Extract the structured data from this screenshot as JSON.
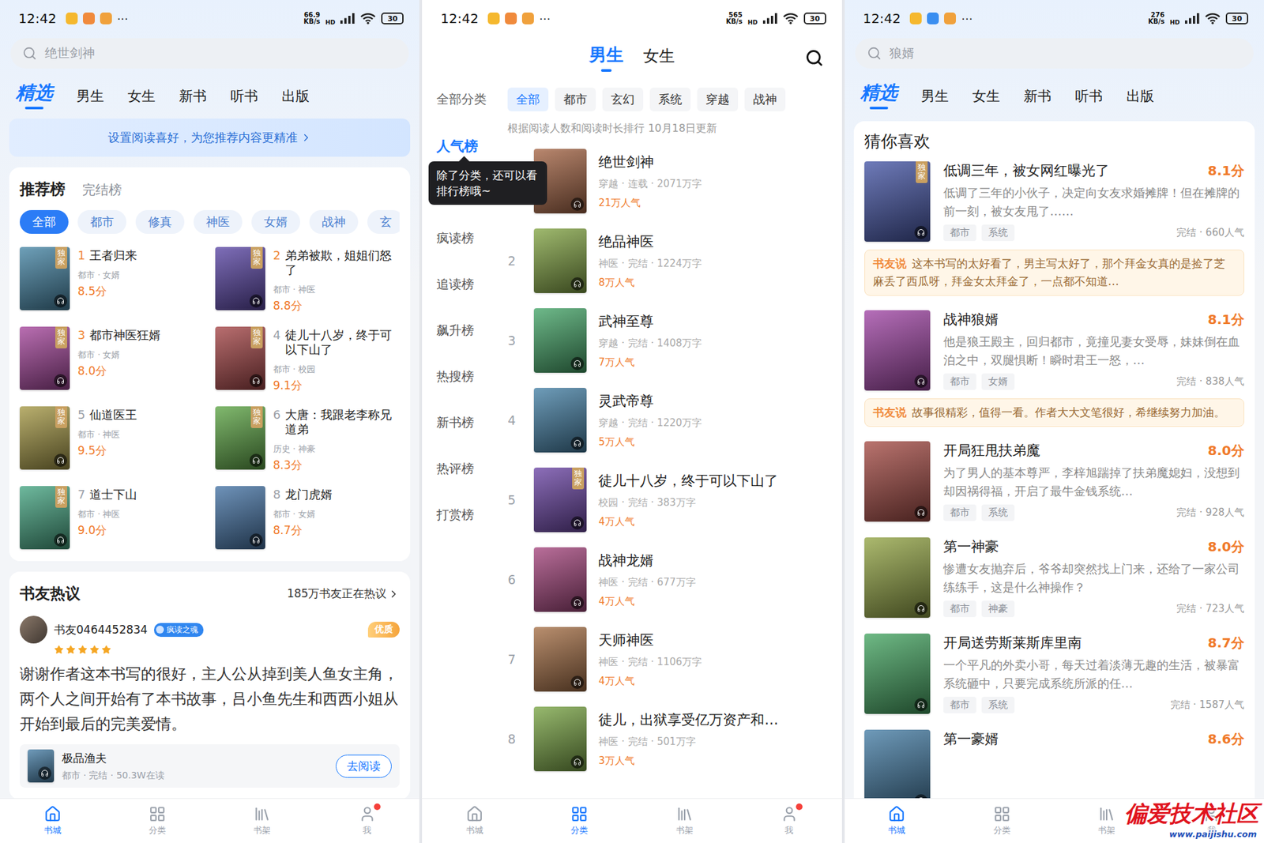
{
  "watermark": {
    "title": "偏爱技术社区",
    "url": "www.paijishu.com"
  },
  "home": {
    "status_bar": {
      "time": "12:42",
      "more": "···",
      "speed": "66.9",
      "speed_unit": "KB/s",
      "network": "HD",
      "battery": "30"
    },
    "search": {
      "placeholder": "绝世剑神"
    },
    "tabs": [
      {
        "label": "精选",
        "selected": true
      },
      {
        "label": "男生",
        "selected": false
      },
      {
        "label": "女生",
        "selected": false
      },
      {
        "label": "新书",
        "selected": false
      },
      {
        "label": "听书",
        "selected": false
      },
      {
        "label": "出版",
        "selected": false
      }
    ],
    "banner": "设置阅读喜好，为您推荐内容更精准",
    "rank": {
      "tabs": [
        {
          "label": "推荐榜",
          "selected": true
        },
        {
          "label": "完结榜",
          "selected": false
        }
      ],
      "chips": [
        {
          "label": "全部",
          "selected": true
        },
        {
          "label": "都市",
          "selected": false
        },
        {
          "label": "修真",
          "selected": false
        },
        {
          "label": "神医",
          "selected": false
        },
        {
          "label": "女婿",
          "selected": false
        },
        {
          "label": "战神",
          "selected": false
        },
        {
          "label": "玄",
          "selected": false
        }
      ],
      "books": [
        {
          "rank": "1",
          "title": "王者归来",
          "meta": "都市 · 女婿",
          "rating": "8.5分",
          "badge": "独家"
        },
        {
          "rank": "2",
          "title": "弟弟被欺，姐姐们怒了",
          "meta": "都市 · 神医",
          "rating": "8.8分",
          "badge": "独家"
        },
        {
          "rank": "3",
          "title": "都市神医狂婿",
          "meta": "都市 · 女婿",
          "rating": "8.0分",
          "badge": "独家"
        },
        {
          "rank": "4",
          "title": "徒儿十八岁，终于可以下山了",
          "meta": "都市 · 校园",
          "rating": "9.1分",
          "badge": "独家"
        },
        {
          "rank": "5",
          "title": "仙道医王",
          "meta": "都市 · 神医",
          "rating": "9.5分",
          "badge": "独家"
        },
        {
          "rank": "6",
          "title": "大唐：我跟老李称兄道弟",
          "meta": "历史 · 神豪",
          "rating": "8.3分",
          "badge": "独家"
        },
        {
          "rank": "7",
          "title": "道士下山",
          "meta": "都市 · 神医",
          "rating": "9.0分",
          "badge": "独家"
        },
        {
          "rank": "8",
          "title": "龙门虎婿",
          "meta": "都市 · 女婿",
          "rating": "8.7分",
          "badge": ""
        }
      ]
    },
    "discussion": {
      "title": "书友热议",
      "count": "185万书友正在热议",
      "comment": {
        "user": "书友0464452834",
        "badge": "疯读之魂",
        "tag": "优质",
        "stars": 5,
        "text": "谢谢作者这本书写的很好，主人公从掉到美人鱼女主角，两个人之间开始有了本书故事，吕小鱼先生和西西小姐从开始到最后的完美爱情。",
        "book": {
          "title": "极品渔夫",
          "meta": "都市 · 完结 · 50.3W在读",
          "button": "去阅读"
        }
      }
    },
    "bottom_nav": [
      {
        "label": "书城",
        "selected": true,
        "dot": false
      },
      {
        "label": "分类",
        "selected": false,
        "dot": false
      },
      {
        "label": "书架",
        "selected": false,
        "dot": false
      },
      {
        "label": "我",
        "selected": false,
        "dot": true
      }
    ]
  },
  "ranking": {
    "status_bar": {
      "time": "12:42",
      "more": "···",
      "speed": "565",
      "speed_unit": "KB/s",
      "network": "HD",
      "battery": "30"
    },
    "tabs": [
      {
        "label": "男生",
        "selected": true
      },
      {
        "label": "女生",
        "selected": false
      }
    ],
    "category": {
      "label": "全部分类",
      "chips": [
        {
          "label": "全部",
          "selected": true
        },
        {
          "label": "都市",
          "selected": false
        },
        {
          "label": "玄幻",
          "selected": false
        },
        {
          "label": "系统",
          "selected": false
        },
        {
          "label": "穿越",
          "selected": false
        },
        {
          "label": "战神",
          "selected": false
        }
      ]
    },
    "sidebar": [
      {
        "label": "人气榜",
        "selected": true
      },
      {
        "label": "疯读榜",
        "selected": false
      },
      {
        "label": "追读榜",
        "selected": false
      },
      {
        "label": "飙升榜",
        "selected": false
      },
      {
        "label": "热搜榜",
        "selected": false
      },
      {
        "label": "新书榜",
        "selected": false
      },
      {
        "label": "热评榜",
        "selected": false
      },
      {
        "label": "打赏榜",
        "selected": false
      }
    ],
    "tooltip": "除了分类，还可以看排行榜哦~",
    "subtitle": "根据阅读人数和阅读时长排行 10月18日更新",
    "books": [
      {
        "rank": "",
        "title": "绝世剑神",
        "meta": "穿越 · 连载 · 2071万字",
        "popularity": "21万人气",
        "badge": ""
      },
      {
        "rank": "2",
        "title": "绝品神医",
        "meta": "神医 · 完结 · 1224万字",
        "popularity": "8万人气",
        "badge": ""
      },
      {
        "rank": "3",
        "title": "武神至尊",
        "meta": "穿越 · 完结 · 1408万字",
        "popularity": "7万人气",
        "badge": ""
      },
      {
        "rank": "4",
        "title": "灵武帝尊",
        "meta": "穿越 · 完结 · 1220万字",
        "popularity": "5万人气",
        "badge": ""
      },
      {
        "rank": "5",
        "title": "徒儿十八岁，终于可以下山了",
        "meta": "校园 · 完结 · 383万字",
        "popularity": "4万人气",
        "badge": "独家"
      },
      {
        "rank": "6",
        "title": "战神龙婿",
        "meta": "神医 · 完结 · 677万字",
        "popularity": "4万人气",
        "badge": ""
      },
      {
        "rank": "7",
        "title": "天师神医",
        "meta": "神医 · 完结 · 1106万字",
        "popularity": "4万人气",
        "badge": ""
      },
      {
        "rank": "8",
        "title": "徒儿，出狱享受亿万资产和…",
        "meta": "神医 · 完结 · 501万字",
        "popularity": "3万人气",
        "badge": ""
      }
    ],
    "bottom_nav": [
      {
        "label": "书城",
        "selected": false,
        "dot": false
      },
      {
        "label": "分类",
        "selected": true,
        "dot": false
      },
      {
        "label": "书架",
        "selected": false,
        "dot": false
      },
      {
        "label": "我",
        "selected": false,
        "dot": true
      }
    ]
  },
  "guess": {
    "status_bar": {
      "time": "12:42",
      "more": "···",
      "speed": "276",
      "speed_unit": "KB/s",
      "network": "HD",
      "battery": "30"
    },
    "search": {
      "placeholder": "狼婿"
    },
    "tabs": [
      {
        "label": "精选",
        "selected": true
      },
      {
        "label": "男生",
        "selected": false
      },
      {
        "label": "女生",
        "selected": false
      },
      {
        "label": "新书",
        "selected": false
      },
      {
        "label": "听书",
        "selected": false
      },
      {
        "label": "出版",
        "selected": false
      }
    ],
    "title": "猜你喜欢",
    "books": [
      {
        "title": "低调三年，被女网红曝光了",
        "rating": "8.1分",
        "badge": "独家",
        "desc": "低调了三年的小伙子，决定向女友求婚摊牌！但在摊牌的前一刻，被女友甩了……",
        "tags": [
          "都市",
          "系统"
        ],
        "status": "完结 · 660人气",
        "review": {
          "label": "书友说",
          "text": "这本书写的太好看了，男主写太好了，那个拜金女真的是捡了芝麻丢了西瓜呀，拜金女太拜金了，一点都不知道…"
        }
      },
      {
        "title": "战神狼婿",
        "rating": "8.1分",
        "badge": "",
        "desc": "他是狼王殿主，回归都市，竟撞见妻女受辱，妹妹倒在血泊之中，双腿惧断！瞬时君王一怒，…",
        "tags": [
          "都市",
          "女婿"
        ],
        "status": "完结 · 838人气",
        "review": {
          "label": "书友说",
          "text": "故事很精彩，值得一看。作者大大文笔很好，希继续努力加油。"
        }
      },
      {
        "title": "开局狂甩扶弟魔",
        "rating": "8.0分",
        "badge": "",
        "desc": "为了男人的基本尊严，李梓旭踹掉了扶弟魔媳妇，没想到却因祸得福，开启了最牛金钱系统…",
        "tags": [
          "都市",
          "系统"
        ],
        "status": "完结 · 928人气",
        "review": null
      },
      {
        "title": "第一神豪",
        "rating": "8.0分",
        "badge": "",
        "desc": "惨遭女友抛弃后，爷爷却突然找上门来，还给了一家公司练练手，这是什么神操作？",
        "tags": [
          "都市",
          "神豪"
        ],
        "status": "完结 · 723人气",
        "review": null
      },
      {
        "title": "开局送劳斯莱斯库里南",
        "rating": "8.7分",
        "badge": "",
        "desc": "一个平凡的外卖小哥，每天过着淡薄无趣的生活，被暴富系统砸中，只要完成系统所派的任…",
        "tags": [
          "都市",
          "系统"
        ],
        "status": "完结 · 1587人气",
        "review": null
      },
      {
        "title": "第一豪婿",
        "rating": "8.6分",
        "badge": "",
        "desc": "",
        "tags": [],
        "status": "",
        "review": null
      }
    ],
    "bottom_nav": [
      {
        "label": "书城",
        "selected": true,
        "dot": false
      },
      {
        "label": "分类",
        "selected": false,
        "dot": false
      },
      {
        "label": "书架",
        "selected": false,
        "dot": false
      },
      {
        "label": "我",
        "selected": false,
        "dot": false
      }
    ]
  }
}
